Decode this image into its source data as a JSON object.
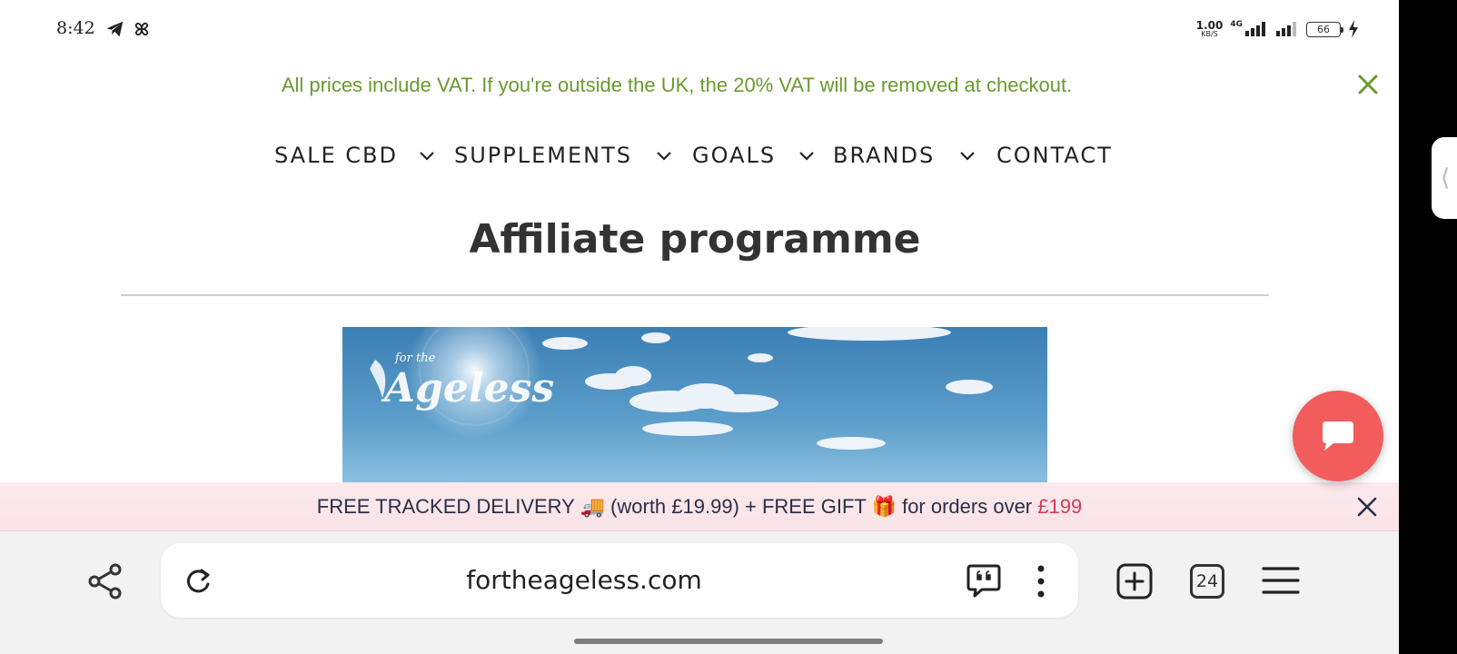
{
  "status_bar": {
    "time": "8:42",
    "net_speed_value": "1.00",
    "net_speed_unit": "KB/S",
    "network_type": "4G",
    "battery": "66",
    "icons": [
      "telegram-icon",
      "pinwheel-icon",
      "signal-icon",
      "battery-icon",
      "charging-icon"
    ]
  },
  "vat_banner": {
    "text": "All prices include VAT. If you're outside the UK, the 20% VAT will be removed at checkout.",
    "color": "#6b9a2e"
  },
  "nav": {
    "items": [
      {
        "label": "SALE CBD",
        "has_dropdown": true
      },
      {
        "label": "SUPPLEMENTS",
        "has_dropdown": true
      },
      {
        "label": "GOALS",
        "has_dropdown": true
      },
      {
        "label": "BRANDS",
        "has_dropdown": true
      },
      {
        "label": "CONTACT",
        "has_dropdown": false
      }
    ]
  },
  "page": {
    "title": "Affiliate programme"
  },
  "hero": {
    "logo_text_small": "for the",
    "logo_text_large": "Ageless"
  },
  "promo": {
    "text_part1": "FREE TRACKED DELIVERY 🚚 (worth £19.99) + FREE GIFT 🎁 for orders over ",
    "price": "£199",
    "price_color": "#d23c5a"
  },
  "browser": {
    "url": "fortheageless.com",
    "tab_count": "24"
  },
  "colors": {
    "chat_fab": "#f25c5c",
    "promo_bg": "#fbe9ec"
  }
}
